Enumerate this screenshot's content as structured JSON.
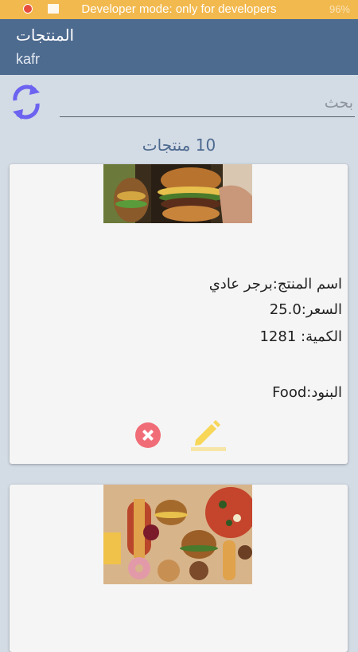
{
  "status_bar": {
    "message": "Developer mode: only for developers",
    "battery": "96%"
  },
  "toolbar": {
    "title": "المنتجات",
    "subtitle": "kafr"
  },
  "search": {
    "placeholder": "بحث",
    "value": ""
  },
  "products_count": "10 منتجات",
  "products": [
    {
      "image": "burger-photo",
      "name_line": "اسم المنتج:برجر عادي",
      "price_line": "السعر:25.0",
      "quantity_line": "الكمية: 1281",
      "category_line": "البنود:Food"
    },
    {
      "image": "fast-food-assortment-photo"
    }
  ],
  "colors": {
    "toolbar": "#4d6a8f",
    "status_bar": "#f2b94e",
    "background": "#d3dbe5",
    "delete": "#f06d78",
    "edit": "#f7d658",
    "refresh": "#6c63f0"
  },
  "icons": [
    "refresh-icon",
    "delete-icon",
    "edit-icon"
  ]
}
